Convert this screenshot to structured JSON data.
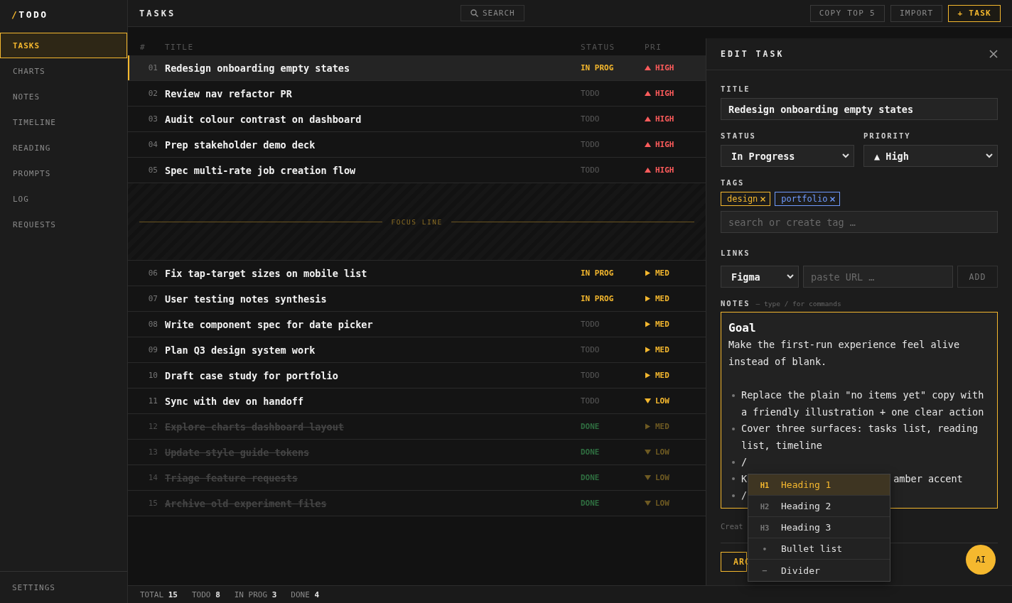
{
  "app": {
    "logo_mark": "/",
    "logo_name": "TODO"
  },
  "sidebar": {
    "items": [
      {
        "label": "TASKS",
        "selected": true
      },
      {
        "label": "CHARTS",
        "selected": false
      },
      {
        "label": "NOTES",
        "selected": false
      },
      {
        "label": "TIMELINE",
        "selected": false
      },
      {
        "label": "READING",
        "selected": false
      },
      {
        "label": "PROMPTS",
        "selected": false
      },
      {
        "label": "LOG",
        "selected": false
      },
      {
        "label": "REQUESTS",
        "selected": false
      }
    ],
    "footer_item": "SETTINGS"
  },
  "topbar": {
    "title": "TASKS",
    "search": "SEARCH",
    "buttons": [
      {
        "label": "COPY TOP 5",
        "kind": "plain"
      },
      {
        "label": "IMPORT",
        "kind": "plain"
      },
      {
        "label": "+ TASK",
        "kind": "primary"
      }
    ]
  },
  "table": {
    "columns": [
      "#",
      "TITLE",
      "STATUS",
      "PRI"
    ],
    "rows": [
      {
        "kind": "task",
        "num": "01",
        "title": "Redesign onboarding empty states",
        "status": {
          "label": "IN PROG",
          "color": "#f5b82e"
        },
        "priority": {
          "kind": "up",
          "label": "HIGH",
          "color": "#ff5c5c"
        },
        "done": false,
        "selected": true
      },
      {
        "kind": "task",
        "num": "02",
        "title": "Review nav refactor PR",
        "status": {
          "label": "TODO",
          "color": "#5a5a5a"
        },
        "priority": {
          "kind": "up",
          "label": "HIGH",
          "color": "#ff5c5c"
        },
        "done": false,
        "selected": false
      },
      {
        "kind": "task",
        "num": "03",
        "title": "Audit colour contrast on dashboard",
        "status": {
          "label": "TODO",
          "color": "#5a5a5a"
        },
        "priority": {
          "kind": "up",
          "label": "HIGH",
          "color": "#ff5c5c"
        },
        "done": false,
        "selected": false
      },
      {
        "kind": "task",
        "num": "04",
        "title": "Prep stakeholder demo deck",
        "status": {
          "label": "TODO",
          "color": "#5a5a5a"
        },
        "priority": {
          "kind": "up",
          "label": "HIGH",
          "color": "#ff5c5c"
        },
        "done": false,
        "selected": false
      },
      {
        "kind": "task",
        "num": "05",
        "title": "Spec multi-rate job creation flow",
        "status": {
          "label": "TODO",
          "color": "#5a5a5a"
        },
        "priority": {
          "kind": "up",
          "label": "HIGH",
          "color": "#ff5c5c"
        },
        "done": false,
        "selected": false
      },
      {
        "kind": "focus",
        "label": "FOCUS LINE"
      },
      {
        "kind": "task",
        "num": "06",
        "title": "Fix tap-target sizes on mobile list",
        "status": {
          "label": "IN PROG",
          "color": "#f5b82e"
        },
        "priority": {
          "kind": "right",
          "label": "MED",
          "color": "#f5b82e"
        },
        "done": false,
        "selected": false
      },
      {
        "kind": "task",
        "num": "07",
        "title": "User testing notes synthesis",
        "status": {
          "label": "IN PROG",
          "color": "#f5b82e"
        },
        "priority": {
          "kind": "right",
          "label": "MED",
          "color": "#f5b82e"
        },
        "done": false,
        "selected": false
      },
      {
        "kind": "task",
        "num": "08",
        "title": "Write component spec for date picker",
        "status": {
          "label": "TODO",
          "color": "#5a5a5a"
        },
        "priority": {
          "kind": "right",
          "label": "MED",
          "color": "#f5b82e"
        },
        "done": false,
        "selected": false
      },
      {
        "kind": "task",
        "num": "09",
        "title": "Plan Q3 design system work",
        "status": {
          "label": "TODO",
          "color": "#5a5a5a"
        },
        "priority": {
          "kind": "right",
          "label": "MED",
          "color": "#f5b82e"
        },
        "done": false,
        "selected": false
      },
      {
        "kind": "task",
        "num": "10",
        "title": "Draft case study for portfolio",
        "status": {
          "label": "TODO",
          "color": "#5a5a5a"
        },
        "priority": {
          "kind": "right",
          "label": "MED",
          "color": "#f5b82e"
        },
        "done": false,
        "selected": false
      },
      {
        "kind": "task",
        "num": "11",
        "title": "Sync with dev on handoff",
        "status": {
          "label": "TODO",
          "color": "#5a5a5a"
        },
        "priority": {
          "kind": "down",
          "label": "LOW",
          "color": "#f5b82e"
        },
        "done": false,
        "selected": false
      },
      {
        "kind": "task",
        "num": "12",
        "title": "Explore charts dashboard layout",
        "status": {
          "label": "DONE",
          "color": "#2f6e40"
        },
        "priority": {
          "kind": "right",
          "label": "MED",
          "color": "#6e5a22"
        },
        "done": true,
        "selected": false
      },
      {
        "kind": "task",
        "num": "13",
        "title": "Update style guide tokens",
        "status": {
          "label": "DONE",
          "color": "#2f6e40"
        },
        "priority": {
          "kind": "down",
          "label": "LOW",
          "color": "#6e5a22"
        },
        "done": true,
        "selected": false
      },
      {
        "kind": "task",
        "num": "14",
        "title": "Triage feature requests",
        "status": {
          "label": "DONE",
          "color": "#2f6e40"
        },
        "priority": {
          "kind": "down",
          "label": "LOW",
          "color": "#6e5a22"
        },
        "done": true,
        "selected": false
      },
      {
        "kind": "task",
        "num": "15",
        "title": "Archive old experiment files",
        "status": {
          "label": "DONE",
          "color": "#2f6e40"
        },
        "priority": {
          "kind": "down",
          "label": "LOW",
          "color": "#6e5a22"
        },
        "done": true,
        "selected": false
      }
    ]
  },
  "edit_panel": {
    "heading": "EDIT TASK",
    "title_label": "TITLE",
    "title_value": "Redesign onboarding empty states",
    "status_label": "STATUS",
    "status_value": "In Progress",
    "priority_label": "PRIORITY",
    "priority_value": "▲ High",
    "tags_label": "TAGS",
    "tags": [
      {
        "label": "design",
        "color": "#f5b82e"
      },
      {
        "label": "portfolio",
        "color": "#6f9bff"
      }
    ],
    "tag_placeholder": "search or create tag …",
    "links_label": "LINKS",
    "link_type": "Figma",
    "link_placeholder": "paste URL …",
    "add_button": "ADD",
    "notes_label": "NOTES",
    "notes_hint": "– type / for commands",
    "notes": {
      "heading": "Goal",
      "paragraph": "Make the first-run experience feel alive instead of blank.",
      "bullets": [
        {
          "text": "Replace the plain \"no items yet\" copy with a friendly illustration + one clear action"
        },
        {
          "text": "Cover three surfaces: tasks list, reading list, timeline"
        },
        {
          "text": "/"
        },
        {
          "text": "K",
          "tail": "amber accent"
        },
        {
          "text": "/"
        }
      ]
    },
    "footer_text": "Creat",
    "archive_button": "ARC"
  },
  "slash_menu": {
    "items": [
      {
        "marker": "H1",
        "label": "Heading 1",
        "selected": true
      },
      {
        "marker": "H2",
        "label": "Heading 2",
        "selected": false
      },
      {
        "marker": "H3",
        "label": "Heading 3",
        "selected": false
      },
      {
        "marker": "•",
        "label": "Bullet list",
        "selected": false
      },
      {
        "marker": "–",
        "label": "Divider",
        "selected": false
      }
    ]
  },
  "ai_button": "AI",
  "status_bar": [
    "TOTAL **15**",
    "TODO **8**",
    "IN PROG **3**",
    "DONE **4**"
  ]
}
